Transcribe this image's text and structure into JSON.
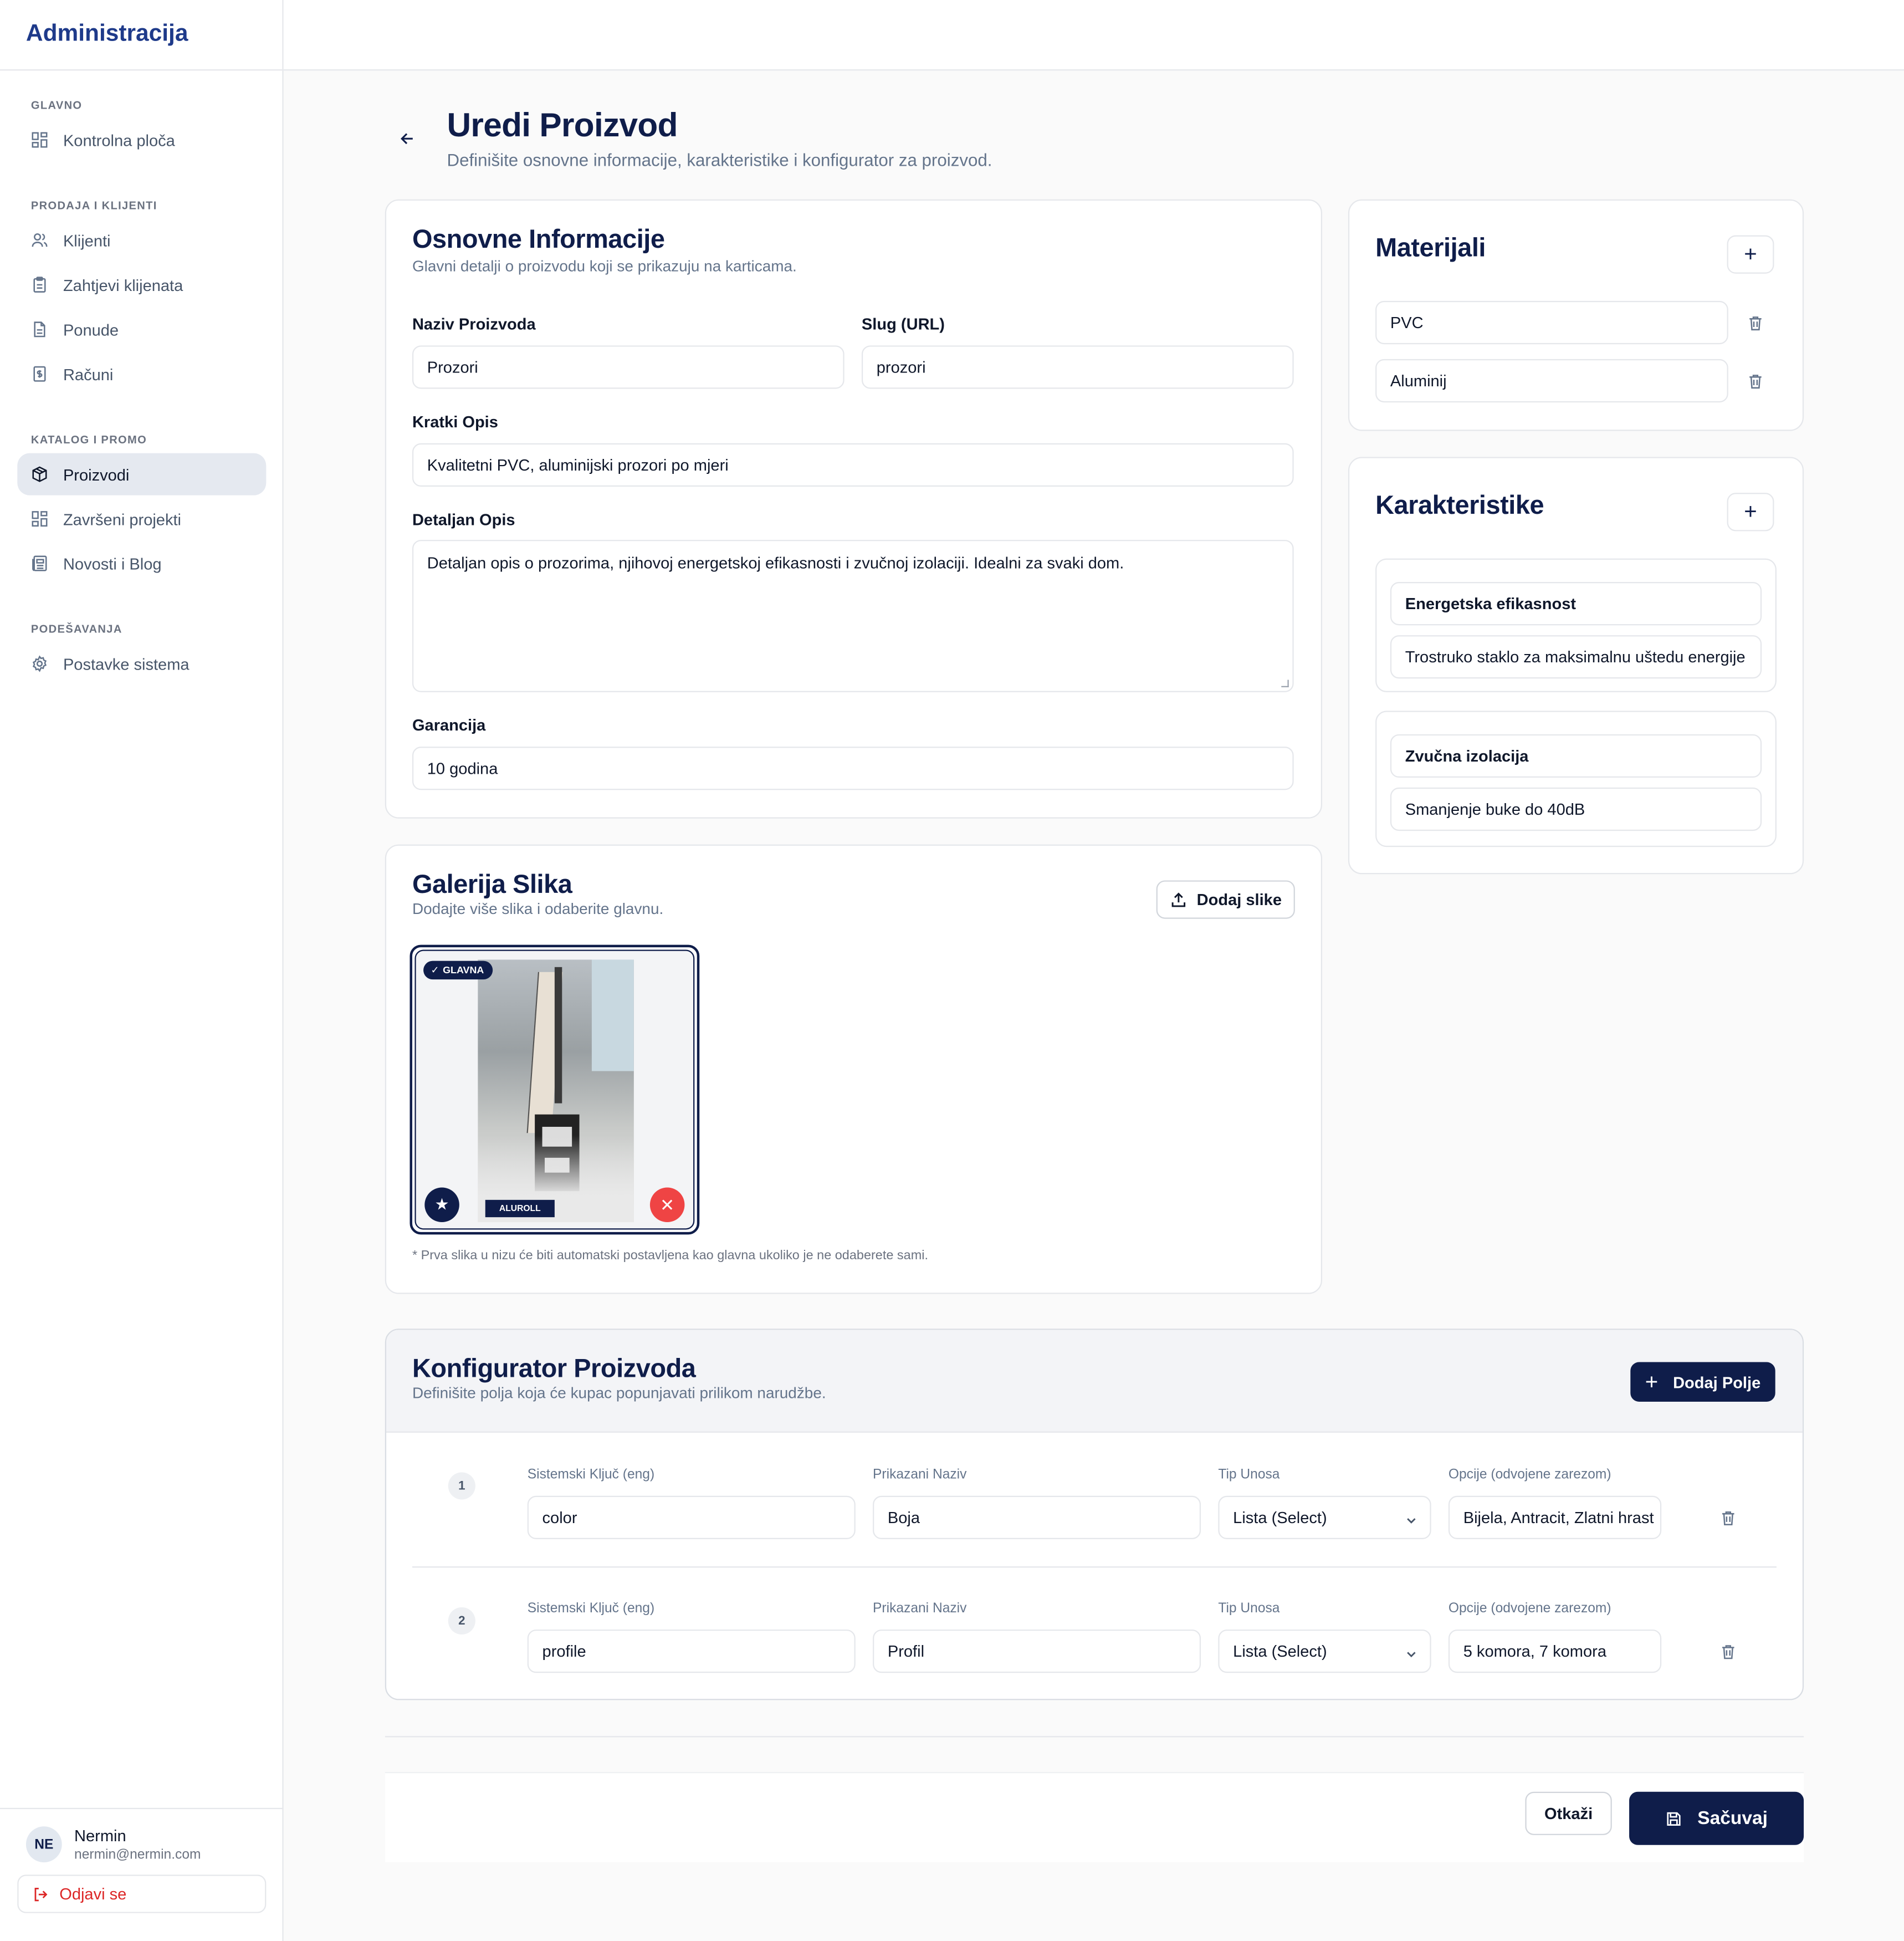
{
  "app": {
    "title": "Administracija"
  },
  "sidebar": {
    "sections": [
      {
        "heading": "GLAVNO",
        "items": [
          {
            "label": "Kontrolna ploča",
            "icon": "dashboard-icon"
          }
        ]
      },
      {
        "heading": "PRODAJA I KLIJENTI",
        "items": [
          {
            "label": "Klijenti",
            "icon": "users-icon"
          },
          {
            "label": "Zahtjevi klijenata",
            "icon": "clipboard-icon"
          },
          {
            "label": "Ponude",
            "icon": "document-icon"
          },
          {
            "label": "Računi",
            "icon": "receipt-icon"
          }
        ]
      },
      {
        "heading": "KATALOG I PROMO",
        "items": [
          {
            "label": "Proizvodi",
            "icon": "package-icon",
            "active": true
          },
          {
            "label": "Završeni projekti",
            "icon": "dashboard-icon"
          },
          {
            "label": "Novosti i Blog",
            "icon": "newspaper-icon"
          }
        ]
      },
      {
        "heading": "PODEŠAVANJA",
        "items": [
          {
            "label": "Postavke sistema",
            "icon": "gear-icon"
          }
        ]
      }
    ],
    "user": {
      "initials": "NE",
      "name": "Nermin",
      "email": "nermin@nermin.com"
    },
    "logout_label": "Odjavi se"
  },
  "header": {
    "title": "Uredi Proizvod",
    "subtitle": "Definišite osnovne informacije, karakteristike i konfigurator za proizvod."
  },
  "basic_info": {
    "title": "Osnovne Informacije",
    "subtitle": "Glavni detalji o proizvodu koji se prikazuju na karticama.",
    "name_label": "Naziv Proizvoda",
    "name_value": "Prozori",
    "slug_label": "Slug (URL)",
    "slug_value": "prozori",
    "short_label": "Kratki Opis",
    "short_value": "Kvalitetni PVC, aluminijski prozori po mjeri",
    "detail_label": "Detaljan Opis",
    "detail_value": "Detaljan opis o prozorima, njihovoj energetskoj efikasnosti i zvučnoj izolaciji. Idealni za svaki dom.",
    "warranty_label": "Garancija",
    "warranty_value": "10 godina"
  },
  "gallery": {
    "title": "Galerija Slika",
    "subtitle": "Dodajte više slika i odaberite glavnu.",
    "add_label": "Dodaj slike",
    "main_badge": "GLAVNA",
    "image_brand": "ALUROLL",
    "note": "* Prva slika u nizu će biti automatski postavljena kao glavna ukoliko je ne odaberete sami."
  },
  "materials": {
    "title": "Materijali",
    "items": [
      "PVC",
      "Aluminij"
    ]
  },
  "features": {
    "title": "Karakteristike",
    "items": [
      {
        "name": "Energetska efikasnost",
        "description": "Trostruko staklo za maksimalnu uštedu energije"
      },
      {
        "name": "Zvučna izolacija",
        "description": "Smanjenje buke do 40dB"
      }
    ]
  },
  "configurator": {
    "title": "Konfigurator Proizvoda",
    "subtitle": "Definišite polja koja će kupac popunjavati prilikom narudžbe.",
    "add_label": "Dodaj Polje",
    "col_key": "Sistemski Ključ (eng)",
    "col_display": "Prikazani Naziv",
    "col_type": "Tip Unosa",
    "col_options": "Opcije (odvojene zarezom)",
    "rows": [
      {
        "num": "1",
        "key": "color",
        "display": "Boja",
        "type": "Lista (Select)",
        "options": "Bijela, Antracit, Zlatni hrast"
      },
      {
        "num": "2",
        "key": "profile",
        "display": "Profil",
        "type": "Lista (Select)",
        "options": "5 komora, 7 komora"
      }
    ]
  },
  "footer": {
    "cancel_label": "Otkaži",
    "save_label": "Sačuvaj"
  },
  "colors": {
    "primary": "#0f1d4a",
    "danger": "#ef4444",
    "border": "#e5e7eb"
  }
}
